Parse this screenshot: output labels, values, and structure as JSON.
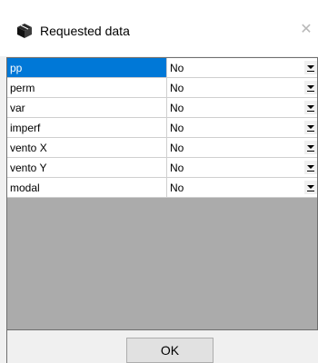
{
  "window": {
    "title": "Requested data",
    "close_symbol": "✕",
    "icon": "box-icon"
  },
  "grid": {
    "rows": [
      {
        "name": "pp",
        "value": "No",
        "selected": true
      },
      {
        "name": "perm",
        "value": "No",
        "selected": false
      },
      {
        "name": "var",
        "value": "No",
        "selected": false
      },
      {
        "name": "imperf",
        "value": "No",
        "selected": false
      },
      {
        "name": "vento X",
        "value": "No",
        "selected": false
      },
      {
        "name": "vento Y",
        "value": "No",
        "selected": false
      },
      {
        "name": "modal",
        "value": "No",
        "selected": false
      }
    ]
  },
  "footer": {
    "ok_label": "OK"
  },
  "colors": {
    "selection": "#0078d7",
    "empty_area": "#ababab",
    "dialog_bg": "#f0f0f0"
  }
}
